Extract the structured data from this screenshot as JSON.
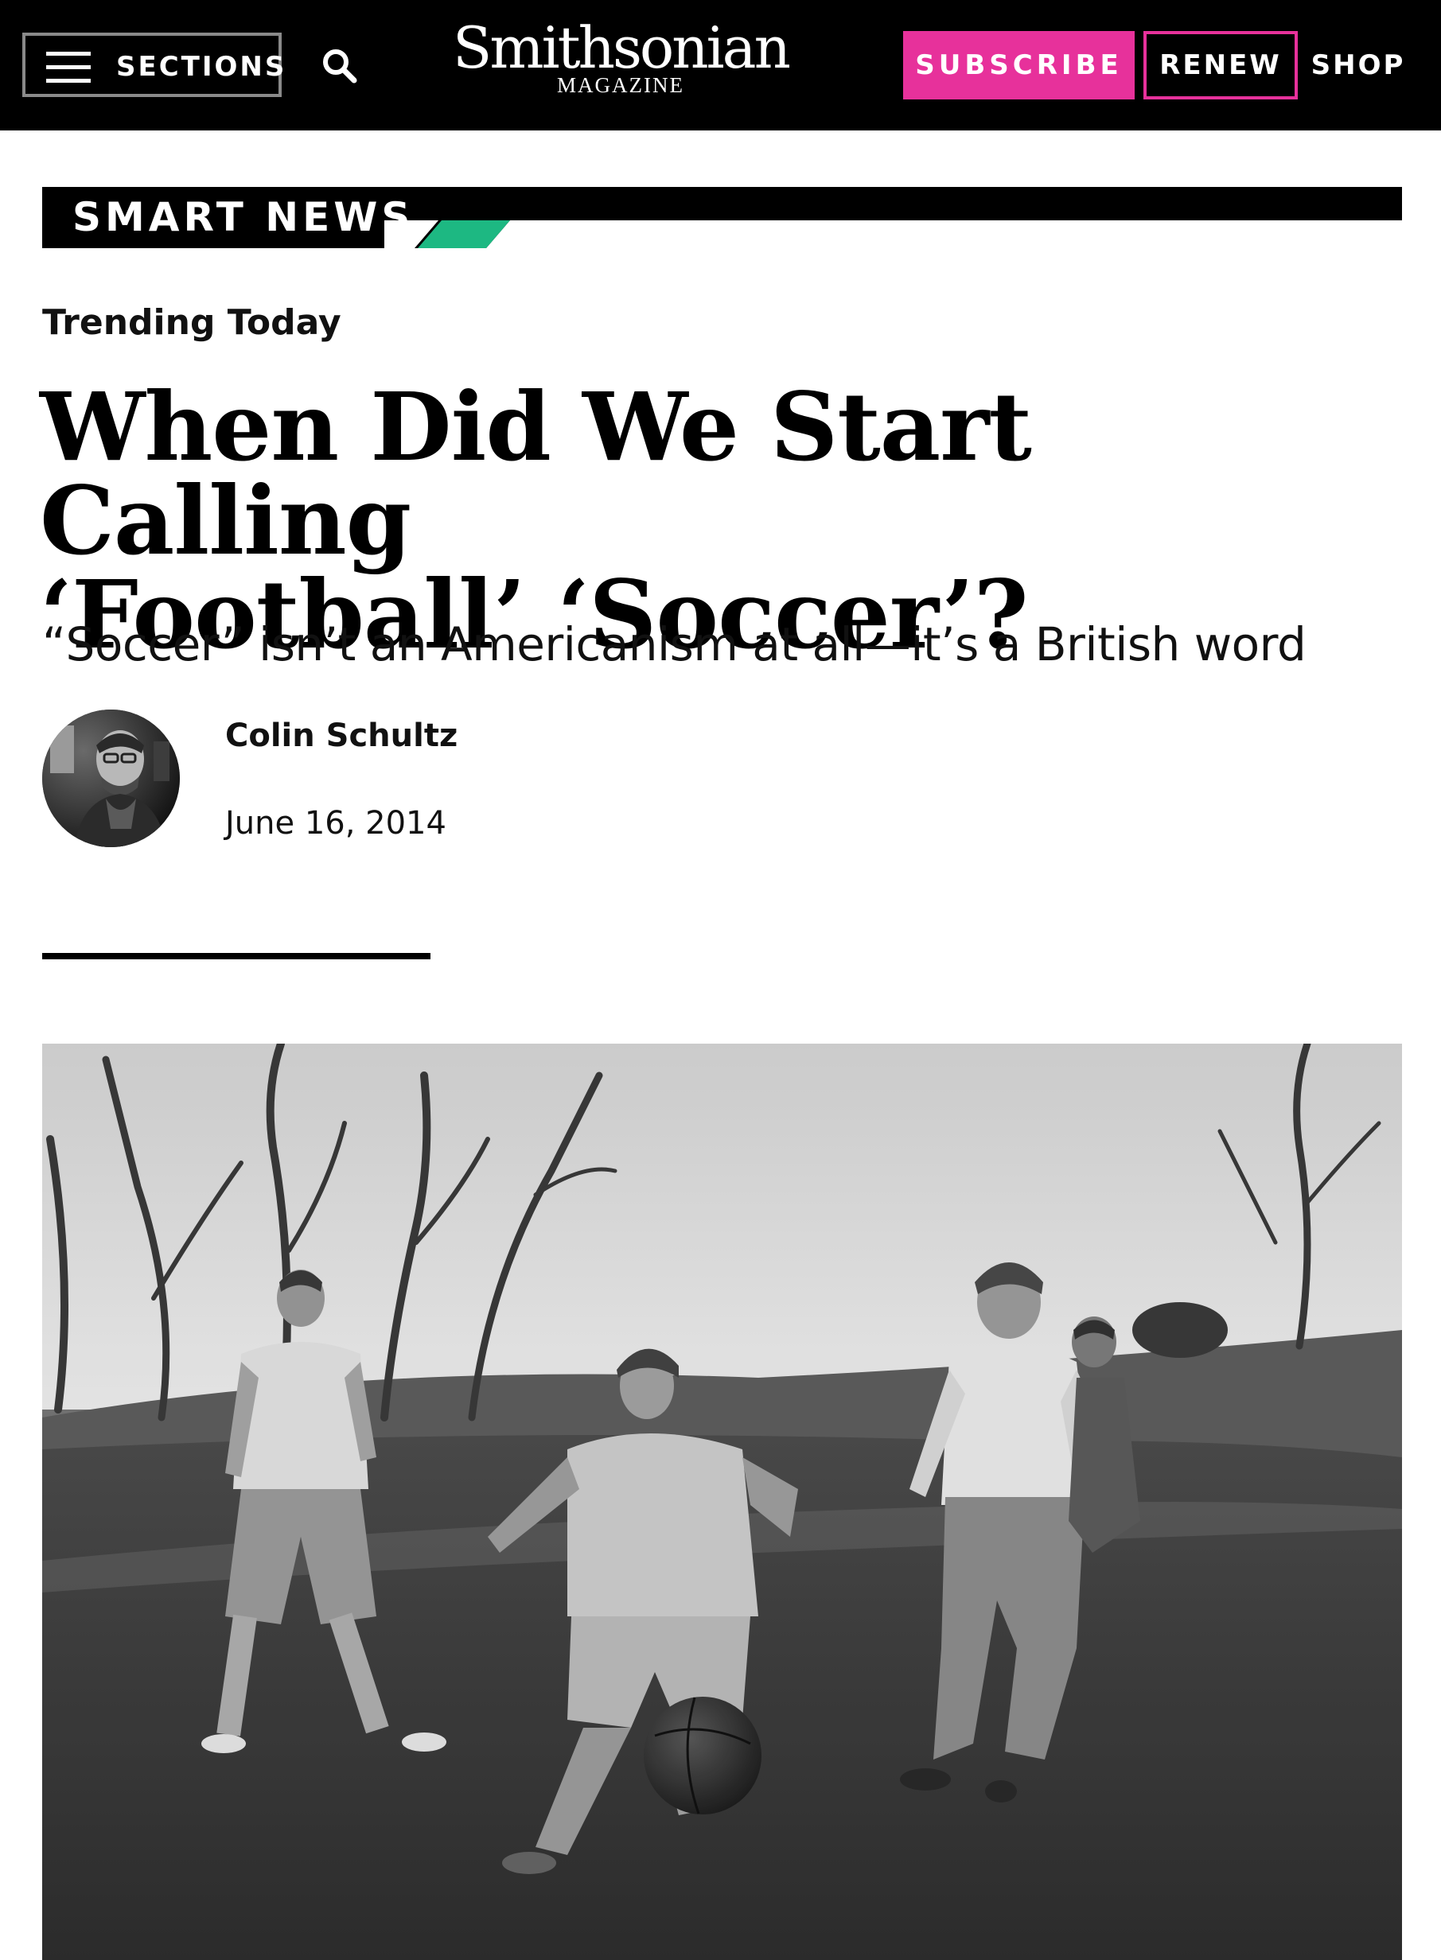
{
  "nav": {
    "sections_label": "SECTIONS",
    "logo_main": "Smithsonian",
    "logo_sub": "MAGAZINE",
    "subscribe_label": "SUBSCRIBE",
    "renew_label": "RENEW",
    "shop_label": "SHOP"
  },
  "section": {
    "label": "SMART NEWS"
  },
  "article": {
    "kicker": "Trending Today",
    "headline_line1": "When Did We Start Calling",
    "headline_line2": "‘Football’ ‘Soccer’?",
    "dek": "“Soccer” isn’t an Americanism at all—it’s a British word",
    "author": "Colin Schultz",
    "date": "June 16, 2014"
  },
  "colors": {
    "nav_background": "#000000",
    "brand_pink": "#e7319b",
    "section_accent_green": "#1db882"
  },
  "icons": {
    "menu": "hamburger-menu-icon",
    "search": "search-icon"
  }
}
